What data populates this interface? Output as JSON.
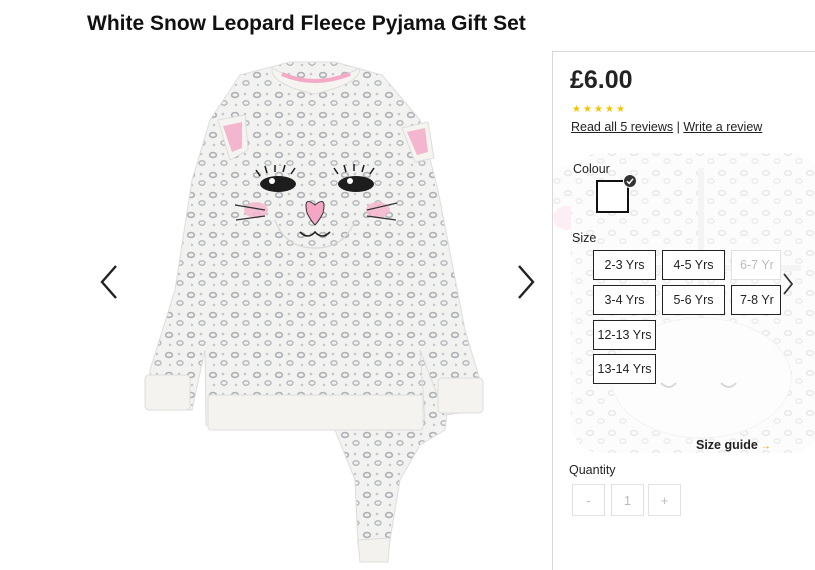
{
  "product": {
    "title": "White Snow Leopard Fleece Pyjama Gift Set",
    "price": "£6.00",
    "rating": 5,
    "rating_max": 5,
    "star_color": "#f5c400"
  },
  "reviews": {
    "read_link": "Read all 5 reviews",
    "separator": "|",
    "write_link": "Write a review"
  },
  "colour": {
    "label": "Colour",
    "selected_swatch": "white"
  },
  "size": {
    "label": "Size",
    "options": [
      {
        "label": "2-3 Yrs",
        "available": true
      },
      {
        "label": "4-5 Yrs",
        "available": true
      },
      {
        "label": "6-7 Yr",
        "available": false
      },
      {
        "label": "3-4 Yrs",
        "available": true
      },
      {
        "label": "5-6 Yrs",
        "available": true
      },
      {
        "label": "7-8 Yr",
        "available": true
      },
      {
        "label": "12-13 Yrs",
        "available": true
      },
      {
        "label": "13-14 Yrs",
        "available": true
      }
    ],
    "guide_label": "Size guide",
    "guide_arrow": "→"
  },
  "quantity": {
    "label": "Quantity",
    "minus": "-",
    "value": "1",
    "plus": "+"
  },
  "icons": {
    "prev": "chevron-left-icon",
    "next": "chevron-right-icon",
    "size_scroll": "chevron-right-icon",
    "swatch_check": "check-icon"
  }
}
